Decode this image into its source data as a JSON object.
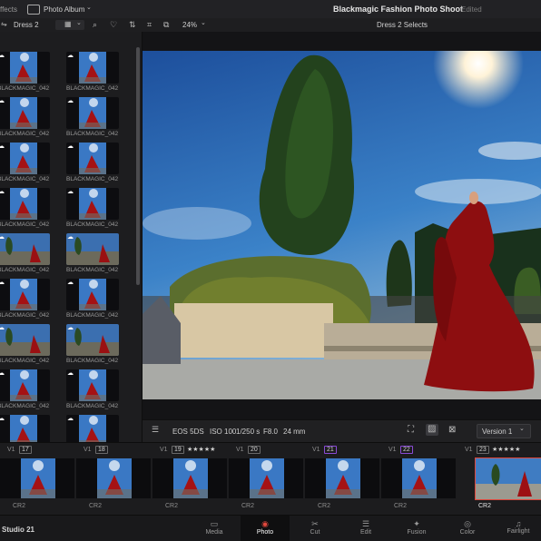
{
  "topbar": {
    "effects_label": "ffects",
    "album_label": "Photo Album",
    "project_title": "Blackmagic Fashion Photo Shoot",
    "project_status": "Edited"
  },
  "toolbar": {
    "album_name": "Dress 2",
    "zoom": "24%",
    "selects_title": "Dress 2 Selects"
  },
  "browser": {
    "tiles": [
      {
        "label": "BLACKMAGIC_042"
      },
      {
        "label": "BLACKMAGIC_042"
      },
      {
        "label": "BLACKMAGIC_042"
      },
      {
        "label": "BLACKMAGIC_042"
      },
      {
        "label": "BLACKMAGIC_042"
      },
      {
        "label": "BLACKMAGIC_042"
      },
      {
        "label": "BLACKMAGIC_042"
      },
      {
        "label": "BLACKMAGIC_042"
      },
      {
        "label": "BLACKMAGIC_042"
      },
      {
        "label": "BLACKMAGIC_042"
      },
      {
        "label": "BLACKMAGIC_042"
      },
      {
        "label": "BLACKMAGIC_042"
      },
      {
        "label": "BLACKMAGIC_042"
      },
      {
        "label": "BLACKMAGIC_042"
      },
      {
        "label": "BLACKMAGIC_042"
      },
      {
        "label": "BLACKMAGIC_042"
      },
      {
        "label": ""
      },
      {
        "label": ""
      }
    ]
  },
  "metadata": {
    "camera": "EOS 5DS",
    "iso": "ISO 100",
    "shutter": "1/250 s",
    "aperture": "F8.0",
    "focal": "24 mm",
    "version": "Version 1"
  },
  "timeline": {
    "clips": [
      {
        "track": "V1",
        "num": "17",
        "stars": "",
        "format": "CR2"
      },
      {
        "track": "V1",
        "num": "18",
        "stars": "",
        "format": "CR2"
      },
      {
        "track": "V1",
        "num": "19",
        "stars": "★★★★★",
        "format": "CR2"
      },
      {
        "track": "V1",
        "num": "20",
        "stars": "",
        "format": "CR2"
      },
      {
        "track": "V1",
        "num": "21",
        "stars": "",
        "format": "CR2"
      },
      {
        "track": "V1",
        "num": "22",
        "stars": "",
        "format": "CR2"
      },
      {
        "track": "V1",
        "num": "23",
        "stars": "★★★★★",
        "format": "CR2"
      }
    ]
  },
  "pages": {
    "app_name": "Studio 21",
    "items": [
      {
        "label": "Media"
      },
      {
        "label": "Photo"
      },
      {
        "label": "Cut"
      },
      {
        "label": "Edit"
      },
      {
        "label": "Fusion"
      },
      {
        "label": "Color"
      },
      {
        "label": "Fairlight"
      }
    ]
  },
  "colors": {
    "accent_purple": "#8a4bd6",
    "selected_red": "#e0473c",
    "sky": "#2f6fb8"
  }
}
